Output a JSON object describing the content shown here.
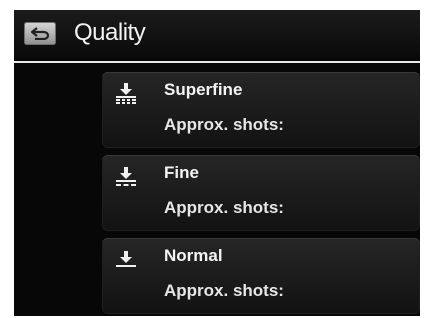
{
  "header": {
    "title": "Quality",
    "back_icon": "back-arrow-icon"
  },
  "options": [
    {
      "name": "Superfine",
      "shots_label": "Approx. shots:",
      "icon": "quality-superfine-icon"
    },
    {
      "name": "Fine",
      "shots_label": "Approx. shots:",
      "icon": "quality-fine-icon"
    },
    {
      "name": "Normal",
      "shots_label": "Approx. shots:",
      "icon": "quality-normal-icon"
    }
  ],
  "colors": {
    "background": "#070707",
    "text": "#f4f4f4",
    "divider": "#e8e8e8",
    "button_face": "#c0c0c0"
  }
}
